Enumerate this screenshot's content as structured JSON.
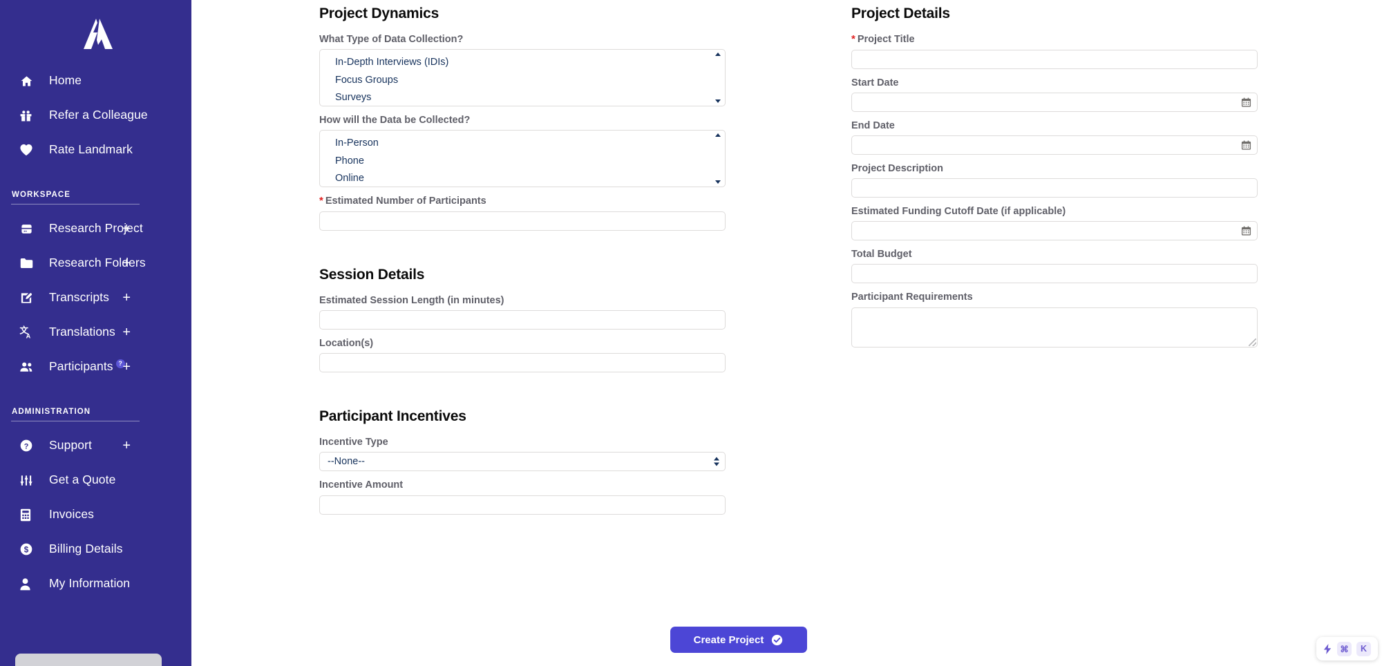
{
  "brand": {
    "logo_name": "landmark-logo",
    "sidebar_bg": "#342e8e",
    "accent": "#4c46d6"
  },
  "sidebar": {
    "top_items": [
      {
        "label": "Home",
        "icon": "home-icon"
      },
      {
        "label": "Refer a Colleague",
        "icon": "gift-icon"
      },
      {
        "label": "Rate Landmark",
        "icon": "heart-icon"
      }
    ],
    "workspace": {
      "title": "WORKSPACE",
      "items": [
        {
          "label": "Research Project",
          "icon": "server-icon",
          "plus": "+"
        },
        {
          "label": "Research Folders",
          "icon": "folder-icon",
          "plus": "+"
        },
        {
          "label": "Transcripts",
          "icon": "edit-note-icon",
          "plus": "+"
        },
        {
          "label": "Translations",
          "icon": "translate-icon",
          "plus": "+"
        },
        {
          "label": "Participants",
          "icon": "people-icon",
          "plus": "+",
          "badge": "?"
        }
      ]
    },
    "administration": {
      "title": "ADMINISTRATION",
      "items": [
        {
          "label": "Support",
          "icon": "question-circle-icon",
          "plus": "+"
        },
        {
          "label": "Get a Quote",
          "icon": "sliders-icon"
        },
        {
          "label": "Invoices",
          "icon": "calculator-icon"
        },
        {
          "label": "Billing Details",
          "icon": "dollar-circle-icon"
        },
        {
          "label": "My Information",
          "icon": "person-icon"
        }
      ]
    }
  },
  "left_column": {
    "project_dynamics": {
      "title": "Project Dynamics",
      "data_collection_type": {
        "label": "What Type of Data Collection?",
        "options": [
          "In-Depth Interviews (IDIs)",
          "Focus Groups",
          "Surveys"
        ]
      },
      "data_collection_method": {
        "label": "How will the Data be Collected?",
        "options": [
          "In-Person",
          "Phone",
          "Online"
        ]
      },
      "participants": {
        "label": "Estimated Number of Participants",
        "required_marker": "*",
        "value": ""
      }
    },
    "session_details": {
      "title": "Session Details",
      "session_length": {
        "label": "Estimated Session Length (in minutes)",
        "value": ""
      },
      "locations": {
        "label": "Location(s)",
        "value": ""
      }
    },
    "participant_incentives": {
      "title": "Participant Incentives",
      "incentive_type": {
        "label": "Incentive Type",
        "selected": "--None--"
      },
      "incentive_amount": {
        "label": "Incentive Amount",
        "value": ""
      }
    }
  },
  "right_column": {
    "project_details": {
      "title": "Project Details",
      "project_title": {
        "label": "Project Title",
        "required_marker": "*",
        "value": ""
      },
      "start_date": {
        "label": "Start Date",
        "value": "",
        "icon": "calendar-icon"
      },
      "end_date": {
        "label": "End Date",
        "value": "",
        "icon": "calendar-icon"
      },
      "project_description": {
        "label": "Project Description",
        "value": ""
      },
      "funding_cutoff": {
        "label": "Estimated Funding Cutoff Date (if applicable)",
        "value": "",
        "icon": "calendar-icon"
      },
      "total_budget": {
        "label": "Total Budget",
        "value": ""
      },
      "participant_requirements": {
        "label": "Participant Requirements",
        "value": ""
      }
    }
  },
  "footer": {
    "create_button": {
      "label": "Create Project",
      "icon": "check-circle-icon"
    }
  },
  "command_hint": {
    "bolt": "lightning-bolt-icon",
    "key_cmd": "⌘",
    "key_letter": "K"
  }
}
